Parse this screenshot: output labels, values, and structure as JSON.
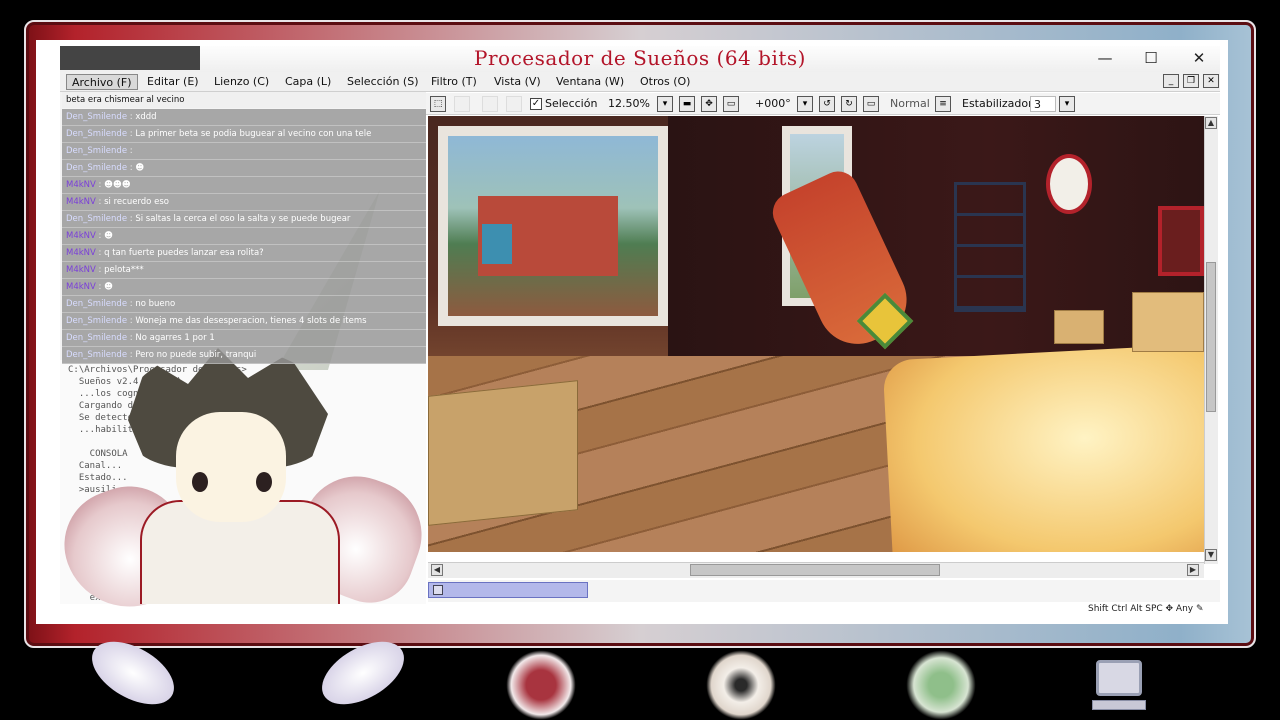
{
  "window": {
    "title": "Procesador de Sueños (64 bits)",
    "controls": {
      "minimize": "—",
      "maximize": "☐",
      "close": "✕"
    }
  },
  "menu": [
    {
      "label": "Archivo (F)"
    },
    {
      "label": "Editar (E)"
    },
    {
      "label": "Lienzo (C)"
    },
    {
      "label": "Capa (L)"
    },
    {
      "label": "Selección (S)"
    },
    {
      "label": "Filtro (T)"
    },
    {
      "label": "Vista (V)"
    },
    {
      "label": "Ventana (W)"
    },
    {
      "label": "Otros (O)"
    }
  ],
  "toolbar": {
    "selection_label": "Selección",
    "selection_checked": true,
    "zoom": "12.50%",
    "rotation": "+000°",
    "blend_mode": "Normal",
    "stabilizer_label": "Estabilizador",
    "stabilizer_value": "3"
  },
  "chat": {
    "header": "beta era chismear al vecino",
    "messages": [
      {
        "user": "Den_Smilende",
        "text": "xddd",
        "user_class": "blue"
      },
      {
        "user": "Den_Smilende",
        "text": "La primer beta se podia buguear al vecino con una tele",
        "user_class": "blue"
      },
      {
        "user": "Den_Smilende",
        "text": "",
        "user_class": "blue"
      },
      {
        "user": "Den_Smilende",
        "text": "",
        "user_class": "blue"
      },
      {
        "user": "M4kNV",
        "text": "",
        "user_class": "purple"
      },
      {
        "user": "M4kNV",
        "text": "si recuerdo eso",
        "user_class": "purple"
      },
      {
        "user": "Den_Smilende",
        "text": "Si saltas la cerca el oso la salta y se puede bugear",
        "user_class": "blue"
      },
      {
        "user": "M4kNV",
        "text": "",
        "user_class": "purple"
      },
      {
        "user": "M4kNV",
        "text": "q tan fuerte puedes lanzar esa rolita?",
        "user_class": "purple"
      },
      {
        "user": "M4kNV",
        "text": "pelota***",
        "user_class": "purple"
      },
      {
        "user": "M4kNV",
        "text": "",
        "user_class": "purple"
      },
      {
        "user": "Den_Smilende",
        "text": "no bueno",
        "user_class": "blue"
      },
      {
        "user": "Den_Smilende",
        "text": "Woneja me das desesperacion, tienes 4 slots de items",
        "user_class": "blue"
      },
      {
        "user": "Den_Smilende",
        "text": "No agarres 1 por 1",
        "user_class": "blue"
      },
      {
        "user": "Den_Smilende",
        "text": "Pero no puede subir, tranqui",
        "user_class": "blue"
      }
    ]
  },
  "console": {
    "text": "C:\\Archivos\\Procesador de Sueños>\n  Sueños v2.4.1 (x64)\n  ...los cognitivos...\n  Cargando desde sueños.cfg ... OK\n  Se detectó sesión de usuario...\n  ...habilitado\n\n    CONSOLA\n  Canal...\n  Estado...\n  >ausili...                    es.\n\n  Comandos de...\n\n    scan\n    load\n    status\n    dream\n    clear\n    exit          Fin\n\n  Nota:                                rme"
  },
  "status": {
    "key_hints": "Shift Ctrl Alt SPC ✥ Any ✎"
  },
  "icons": {
    "dock": [
      "heart-wings-icon",
      "eye-wings-icon",
      "green-orb-wings-icon",
      "computer-icon"
    ]
  }
}
